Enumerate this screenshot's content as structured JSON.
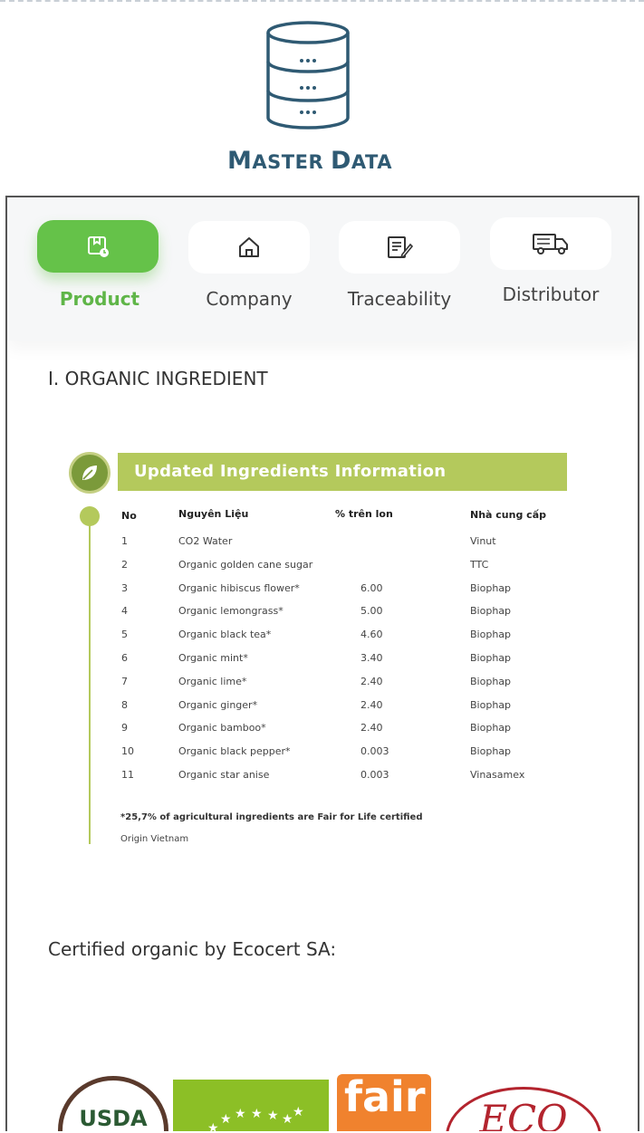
{
  "header": {
    "title_first": "M",
    "title_rest1": "ASTER ",
    "title_second": "D",
    "title_rest2": "ATA",
    "icon": "database-icon"
  },
  "tabs": [
    {
      "label": "Product",
      "icon": "product-box-icon",
      "active": true
    },
    {
      "label": "Company",
      "icon": "home-icon",
      "active": false
    },
    {
      "label": "Traceability",
      "icon": "document-edit-icon",
      "active": false
    },
    {
      "label": "Distributor",
      "icon": "truck-icon",
      "active": false
    }
  ],
  "section_heading": "I. ORGANIC INGREDIENT",
  "ingredients": {
    "banner_title": "Updated Ingredients Information",
    "columns": {
      "no": "No",
      "name": "Nguyên Liệu",
      "percent": "% trên lon",
      "supplier": "Nhà cung cấp"
    },
    "rows": [
      {
        "no": "1",
        "name": "CO2 Water",
        "percent": "",
        "supplier": "Vinut"
      },
      {
        "no": "2",
        "name": "Organic golden cane sugar",
        "percent": "",
        "supplier": "TTC"
      },
      {
        "no": "3",
        "name": "Organic hibiscus flower*",
        "percent": "6.00",
        "supplier": "Biophap"
      },
      {
        "no": "4",
        "name": "Organic lemongrass*",
        "percent": "5.00",
        "supplier": "Biophap"
      },
      {
        "no": "5",
        "name": "Organic black tea*",
        "percent": "4.60",
        "supplier": "Biophap"
      },
      {
        "no": "6",
        "name": "Organic mint*",
        "percent": "3.40",
        "supplier": "Biophap"
      },
      {
        "no": "7",
        "name": "Organic lime*",
        "percent": "2.40",
        "supplier": "Biophap"
      },
      {
        "no": "8",
        "name": "Organic ginger*",
        "percent": "2.40",
        "supplier": "Biophap"
      },
      {
        "no": "9",
        "name": "Organic bamboo*",
        "percent": "2.40",
        "supplier": "Biophap"
      },
      {
        "no": "10",
        "name": "Organic black pepper*",
        "percent": "0.003",
        "supplier": "Biophap"
      },
      {
        "no": "11",
        "name": "Organic star anise",
        "percent": "0.003",
        "supplier": "Vinasamex"
      }
    ],
    "note_fair": "*25,7% of agricultural ingredients are Fair for Life certified",
    "note_origin": "Origin Vietnam"
  },
  "certification": {
    "heading": "Certified organic by Ecocert SA:",
    "logos": [
      {
        "name": "usda-logo",
        "text": "USDA"
      },
      {
        "name": "eu-organic-logo",
        "text": ""
      },
      {
        "name": "fair-for-life-logo",
        "text": "fair"
      },
      {
        "name": "ecocert-logo",
        "text": "ECO"
      }
    ]
  },
  "colors": {
    "accent_green": "#65c249",
    "title_blue": "#2f5a73",
    "banner_green": "#b4c95c"
  }
}
